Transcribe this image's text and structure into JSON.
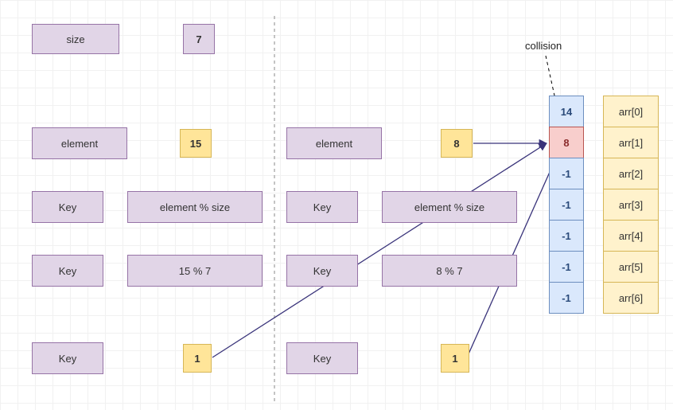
{
  "size_label": "size",
  "size_value": "7",
  "collision_label": "collision",
  "left": {
    "element_label": "element",
    "element_value": "15",
    "key1_label": "Key",
    "key1_value": "element % size",
    "key2_label": "Key",
    "key2_value": "15 % 7",
    "key3_label": "Key",
    "key3_value": "1"
  },
  "right": {
    "element_label": "element",
    "element_value": "8",
    "key1_label": "Key",
    "key1_value": "element % size",
    "key2_label": "Key",
    "key2_value": "8 % 7",
    "key3_label": "Key",
    "key3_value": "1"
  },
  "table": {
    "cells": [
      "14",
      "8",
      "-1",
      "-1",
      "-1",
      "-1",
      "-1"
    ],
    "collision_index": 1,
    "indices": [
      "arr[0]",
      "arr[1]",
      "arr[2]",
      "arr[3]",
      "arr[4]",
      "arr[5]",
      "arr[6]"
    ]
  }
}
